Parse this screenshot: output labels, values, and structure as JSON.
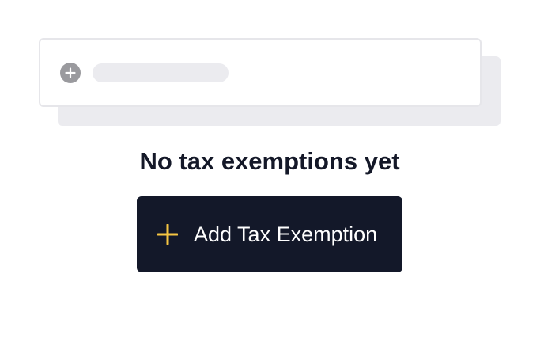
{
  "empty_state": {
    "illustration": {
      "icon": "plus-circle-icon",
      "icon_color": "#9a9a9e",
      "skeleton_color": "#ebebef"
    },
    "heading": "No tax exemptions yet",
    "add_button": {
      "label": "Add Tax Exemption",
      "icon": "plus-icon",
      "background": "#131829",
      "icon_color": "#f5c542",
      "text_color": "#ffffff"
    }
  }
}
